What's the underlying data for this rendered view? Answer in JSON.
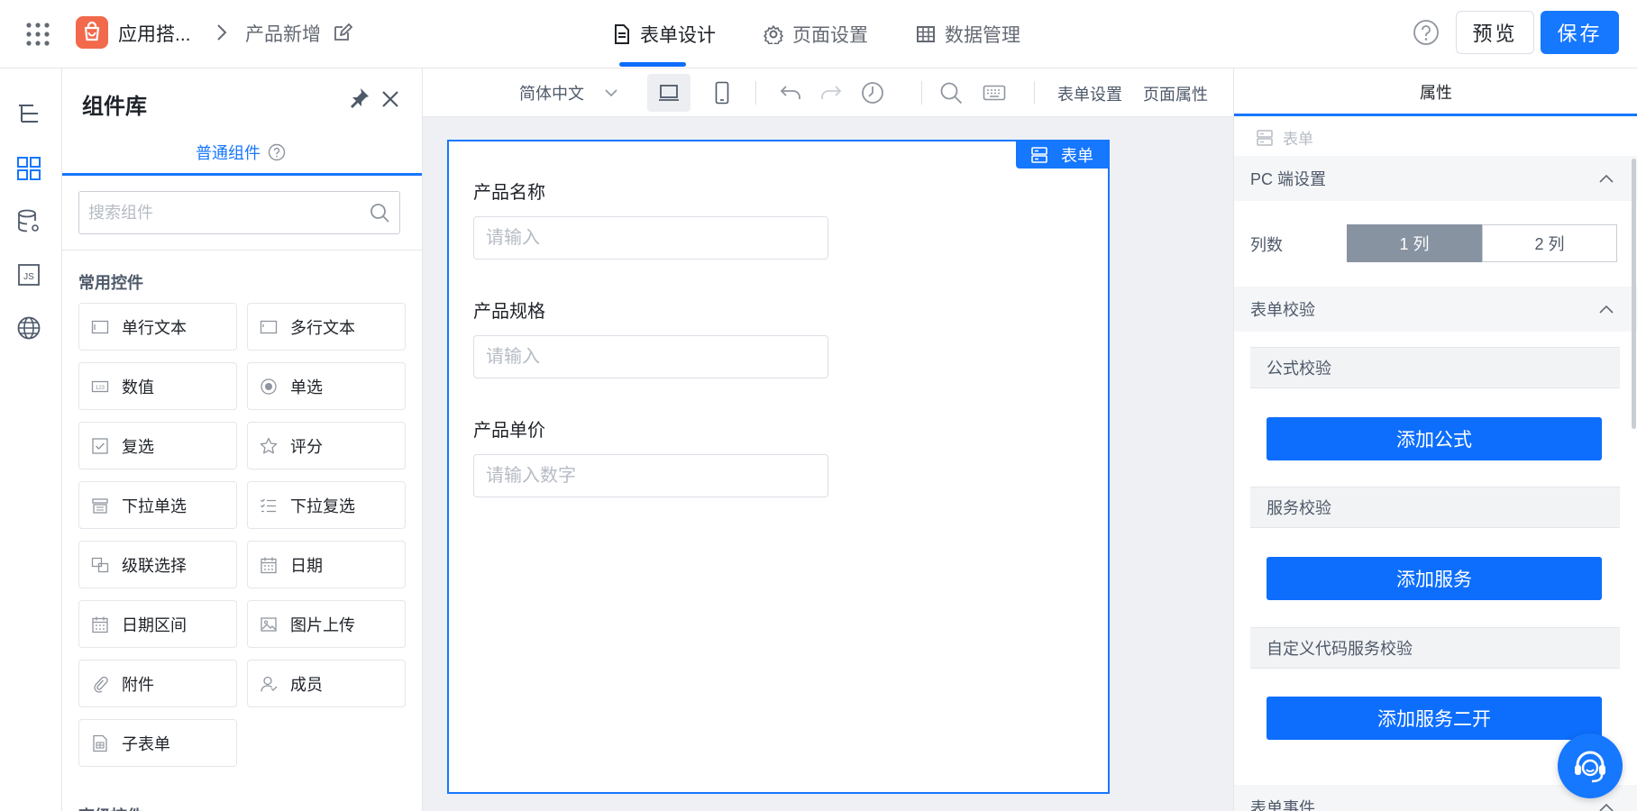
{
  "header": {
    "app_name": "应用搭...",
    "page_name": "产品新增",
    "tabs": [
      {
        "label": "表单设计"
      },
      {
        "label": "页面设置"
      },
      {
        "label": "数据管理"
      }
    ],
    "preview_label": "预览",
    "save_label": "保存",
    "accent": "#1677ff"
  },
  "panel": {
    "title": "组件库",
    "tab_label": "普通组件",
    "search_placeholder": "搜索组件",
    "section_title": "常用控件",
    "section_title_2": "高级控件",
    "components": [
      {
        "label": "单行文本",
        "icon": "single-line-text-icon"
      },
      {
        "label": "多行文本",
        "icon": "multi-line-text-icon"
      },
      {
        "label": "数值",
        "icon": "number-icon"
      },
      {
        "label": "单选",
        "icon": "radio-icon"
      },
      {
        "label": "复选",
        "icon": "checkbox-icon"
      },
      {
        "label": "评分",
        "icon": "star-icon"
      },
      {
        "label": "下拉单选",
        "icon": "dropdown-single-icon"
      },
      {
        "label": "下拉复选",
        "icon": "dropdown-multi-icon"
      },
      {
        "label": "级联选择",
        "icon": "cascade-icon"
      },
      {
        "label": "日期",
        "icon": "calendar-icon"
      },
      {
        "label": "日期区间",
        "icon": "date-range-icon"
      },
      {
        "label": "图片上传",
        "icon": "image-upload-icon"
      },
      {
        "label": "附件",
        "icon": "attachment-icon"
      },
      {
        "label": "成员",
        "icon": "member-icon"
      },
      {
        "label": "子表单",
        "icon": "subform-icon"
      }
    ]
  },
  "canvas": {
    "language": "简体中文",
    "form_settings_label": "表单设置",
    "page_props_label": "页面属性",
    "form_badge": "表单",
    "fields": [
      {
        "label": "产品名称",
        "placeholder": "请输入"
      },
      {
        "label": "产品规格",
        "placeholder": "请输入"
      },
      {
        "label": "产品单价",
        "placeholder": "请输入数字"
      }
    ]
  },
  "props": {
    "tab_label": "属性",
    "crumb": "表单",
    "pc_section": "PC 端设置",
    "columns_label": "列数",
    "col_1": "1 列",
    "col_2": "2 列",
    "validation_section": "表单校验",
    "formula_validation": "公式校验",
    "add_formula": "添加公式",
    "service_validation": "服务校验",
    "add_service": "添加服务",
    "custom_validation": "自定义代码服务校验",
    "add_service_ext": "添加服务二开",
    "events_section": "表单事件"
  }
}
